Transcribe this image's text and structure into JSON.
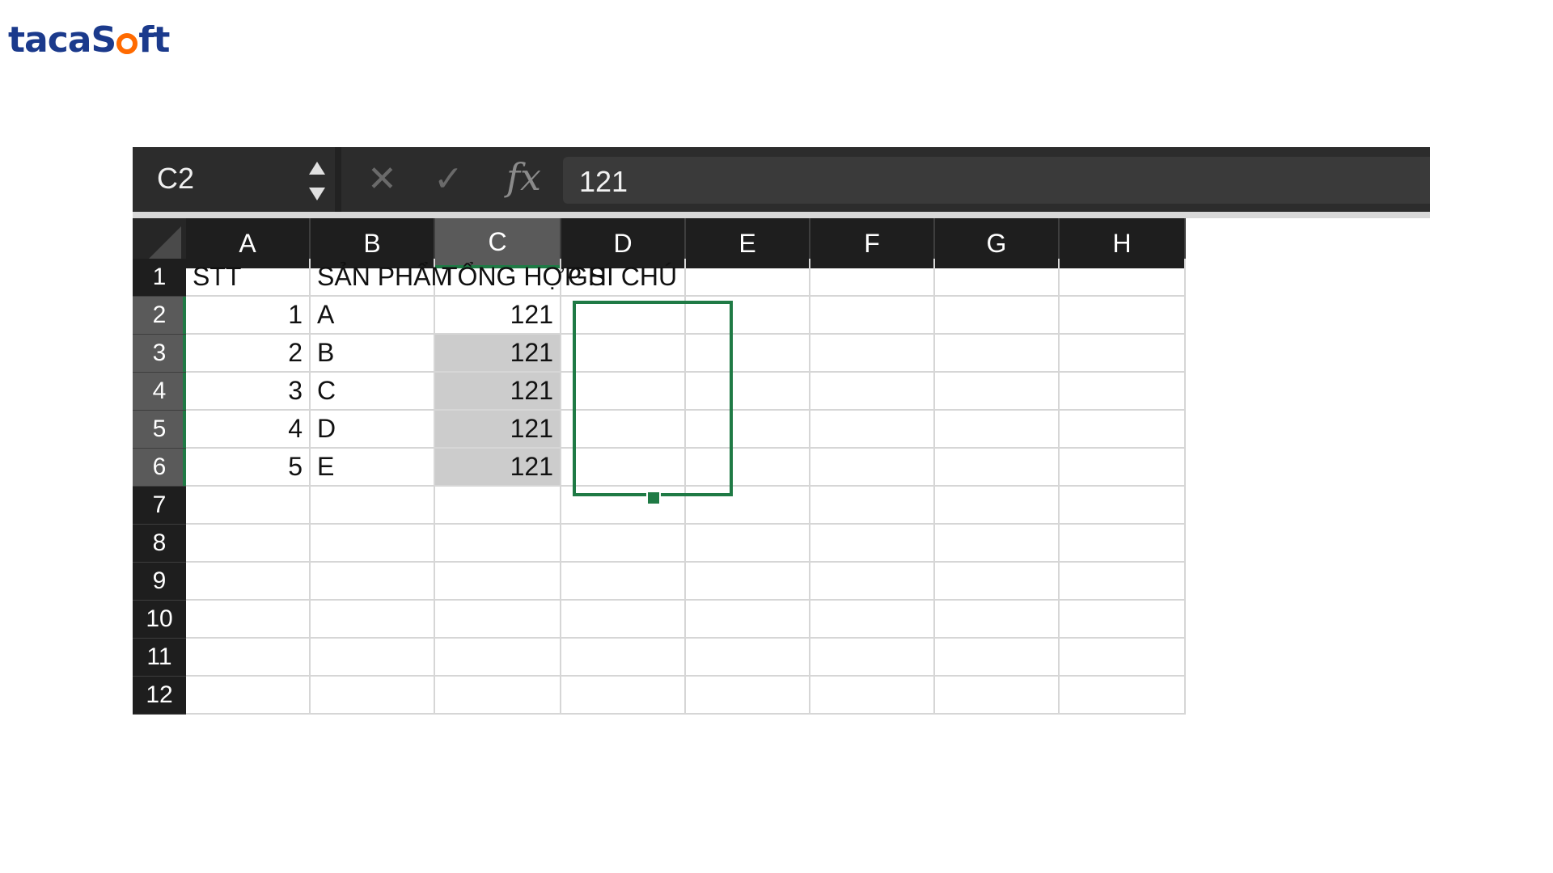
{
  "brand": {
    "prefix": "taca",
    "s": "S",
    "suffix": "ft",
    "text_color": "#1b3a8c",
    "accent_color": "#ff6a00"
  },
  "formula_bar": {
    "cell_ref": "C2",
    "spin_up_icon": "triangle-up",
    "spin_down_icon": "triangle-down",
    "cancel_symbol": "✕",
    "enter_symbol": "✓",
    "fx_symbol": "fx",
    "value": "121"
  },
  "grid": {
    "columns": [
      "A",
      "B",
      "C",
      "D",
      "E",
      "F",
      "G",
      "H"
    ],
    "selected_column": "C",
    "rows": [
      "1",
      "2",
      "3",
      "4",
      "5",
      "6",
      "7",
      "8",
      "9",
      "10",
      "11",
      "12"
    ],
    "selected_rows": [
      "2",
      "3",
      "4",
      "5",
      "6"
    ],
    "cells": {
      "A1": "STT",
      "B1": "SẢN PHẨM",
      "C1": "TỔNG HỢP S",
      "D1": "GHI CHÚ",
      "A2": "1",
      "B2": "A",
      "C2": "121",
      "A3": "2",
      "B3": "B",
      "C3": "121",
      "A4": "3",
      "B4": "C",
      "C4": "121",
      "A5": "4",
      "B5": "D",
      "C5": "121",
      "A6": "5",
      "B6": "E",
      "C6": "121"
    },
    "selection_range": "C2:C6",
    "selection_color": "#1f7a45",
    "highlight_color": "#cccccc"
  }
}
